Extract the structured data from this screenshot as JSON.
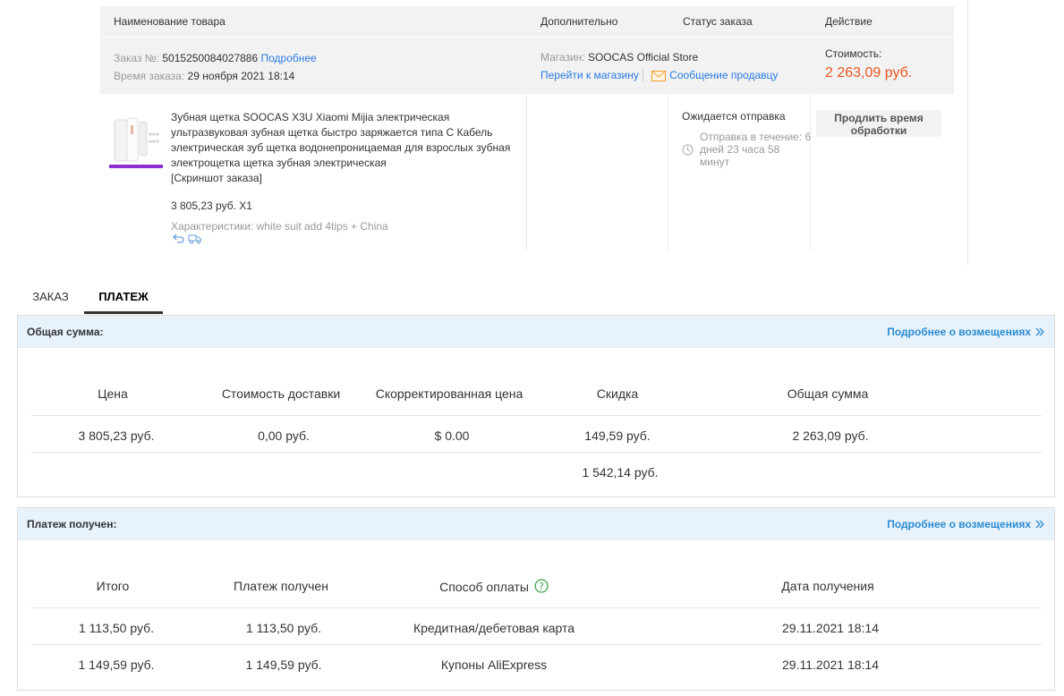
{
  "order_table": {
    "headers": {
      "product": "Наименование товара",
      "extra": "Дополнительно",
      "status": "Статус заказа",
      "action": "Действие"
    },
    "order_no_label": "Заказ №:",
    "order_no": "5015250084027886",
    "details_link": "Подробнее",
    "order_time_label": "Время заказа:",
    "order_time": "29 ноября 2021 18:14",
    "store_label": "Магазин:",
    "store_name": "SOOCAS Official Store",
    "go_to_store": "Перейти к магазину",
    "message_seller": "Сообщение продавцу",
    "cost_label": "Стоимость:",
    "cost_value": "2 263,09 руб.",
    "product": {
      "title": "Зубная щетка SOOCAS X3U Xiaomi Mijia электрическая ультразвуковая зубная щетка быстро заряжается типа C Кабель электрическая зуб щетка водонепроницаемая для взрослых зубная электрощетка щетка зубная электрическая",
      "screenshot_link": "[Скриншот заказа]",
      "price_qty": "3 805,23 руб. X1",
      "characteristics": "Характеристики: white suit add 4tips + China"
    },
    "status": "Ожидается отправка",
    "shipping_note": "Отправка в течение: 6 дней 23 часа 58 минут",
    "extend_button": "Продлить время обработки"
  },
  "tabs": [
    {
      "label": "ЗАКАЗ"
    },
    {
      "label": "ПЛАТЕЖ"
    }
  ],
  "total_panel": {
    "title": "Общая сумма:",
    "more_link": "Подробнее о возмещениях",
    "headers": [
      "Цена",
      "Стоимость доставки",
      "Скорректированная цена",
      "Скидка",
      "Общая сумма"
    ],
    "row": [
      "3 805,23 руб.",
      "0,00 руб.",
      "$ 0.00",
      "149,59 руб.",
      "2 263,09 руб."
    ],
    "extra_discount": "1 542,14 руб."
  },
  "payment_panel": {
    "title": "Платеж получен:",
    "more_link": "Подробнее о возмещениях",
    "headers": [
      "Итого",
      "Платеж получен",
      "Способ оплаты",
      "Дата получения"
    ],
    "rows": [
      [
        "1 113,50 руб.",
        "1 113,50 руб.",
        "Кредитная/дебетовая карта",
        "29.11.2021 18:14"
      ],
      [
        "1 149,59 руб.",
        "1 149,59 руб.",
        "Купоны AliExpress",
        "29.11.2021 18:14"
      ]
    ]
  },
  "colors": {
    "accent_link": "#2a7ae2",
    "price_red": "#e8541e",
    "panel_head_bg": "#e8f2fb",
    "help_green": "#3aa74a"
  },
  "icons": [
    "mail-icon",
    "clock-icon",
    "return-icon",
    "truck-icon",
    "help-icon",
    "double-chevron-right-icon"
  ]
}
